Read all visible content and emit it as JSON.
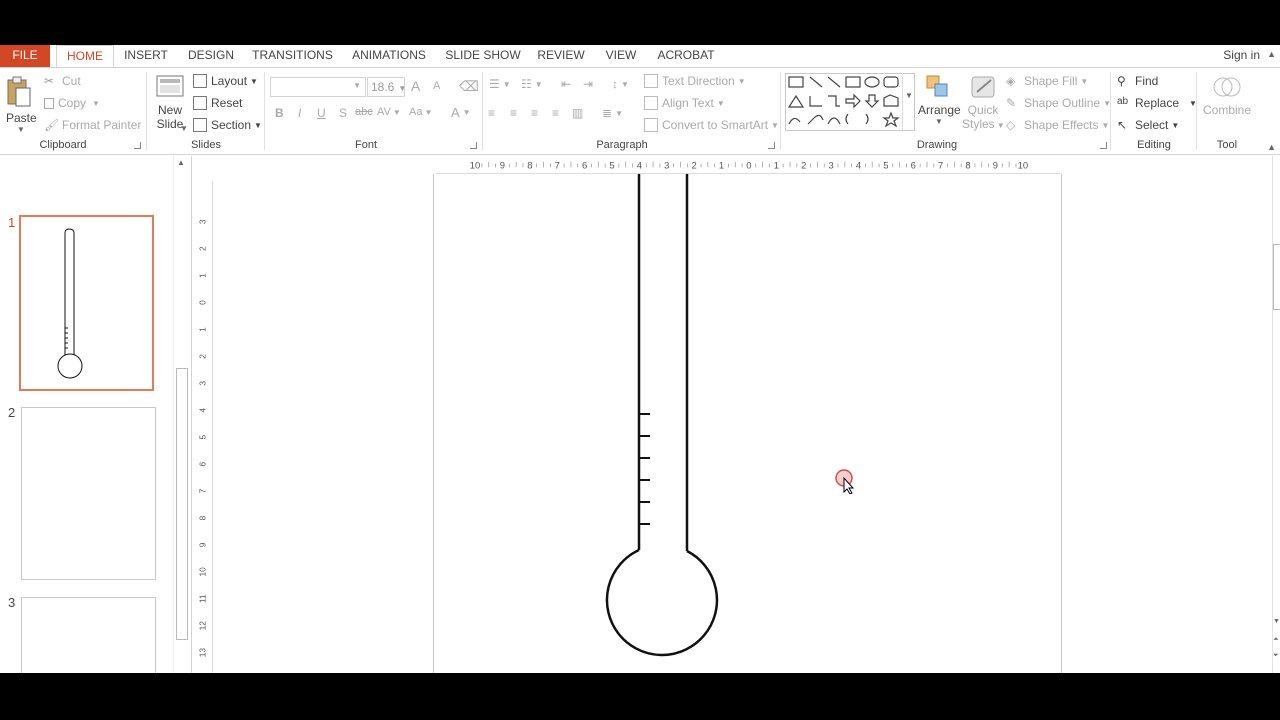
{
  "tabs": [
    "FILE",
    "HOME",
    "INSERT",
    "DESIGN",
    "TRANSITIONS",
    "ANIMATIONS",
    "SLIDE SHOW",
    "REVIEW",
    "VIEW",
    "ACROBAT"
  ],
  "signin": "Sign in",
  "clipboard": {
    "paste": "Paste",
    "cut": "Cut",
    "copy": "Copy",
    "format_painter": "Format Painter",
    "label": "Clipboard"
  },
  "slides_group": {
    "new_slide_1": "New",
    "new_slide_2": "Slide",
    "layout": "Layout",
    "reset": "Reset",
    "section": "Section",
    "label": "Slides"
  },
  "font": {
    "size": "18.6",
    "bold": "B",
    "italic": "I",
    "underline": "U",
    "shadow": "S",
    "strike": "abc",
    "spacing": "AV",
    "case": "Aa",
    "color": "A",
    "grow": "A",
    "shrink": "A",
    "label": "Font"
  },
  "paragraph": {
    "text_direction": "Text Direction",
    "align_text": "Align Text",
    "smartart": "Convert to SmartArt",
    "label": "Paragraph"
  },
  "drawing": {
    "arrange": "Arrange",
    "quick_styles_1": "Quick",
    "quick_styles_2": "Styles",
    "shape_fill": "Shape Fill",
    "shape_outline": "Shape Outline",
    "shape_effects": "Shape Effects",
    "label": "Drawing"
  },
  "editing": {
    "find": "Find",
    "replace": "Replace",
    "select": "Select",
    "label": "Editing"
  },
  "tool": {
    "combine": "Combine",
    "label": "Tool"
  },
  "slide_numbers": [
    "1",
    "2",
    "3"
  ],
  "hruler_labels": [
    "10",
    "9",
    "8",
    "7",
    "6",
    "5",
    "4",
    "3",
    "2",
    "1",
    "0",
    "1",
    "2",
    "3",
    "4",
    "5",
    "6",
    "7",
    "8",
    "9",
    "10"
  ],
  "vruler_labels": [
    "3",
    "2",
    "1",
    "0",
    "1",
    "2",
    "3",
    "4",
    "5",
    "6",
    "7",
    "8",
    "9",
    "10",
    "11",
    "12",
    "13"
  ],
  "colors": {
    "accent": "#d24726",
    "ribbon_border": "#d4d4d4",
    "thumb_active": "#e07a58"
  }
}
